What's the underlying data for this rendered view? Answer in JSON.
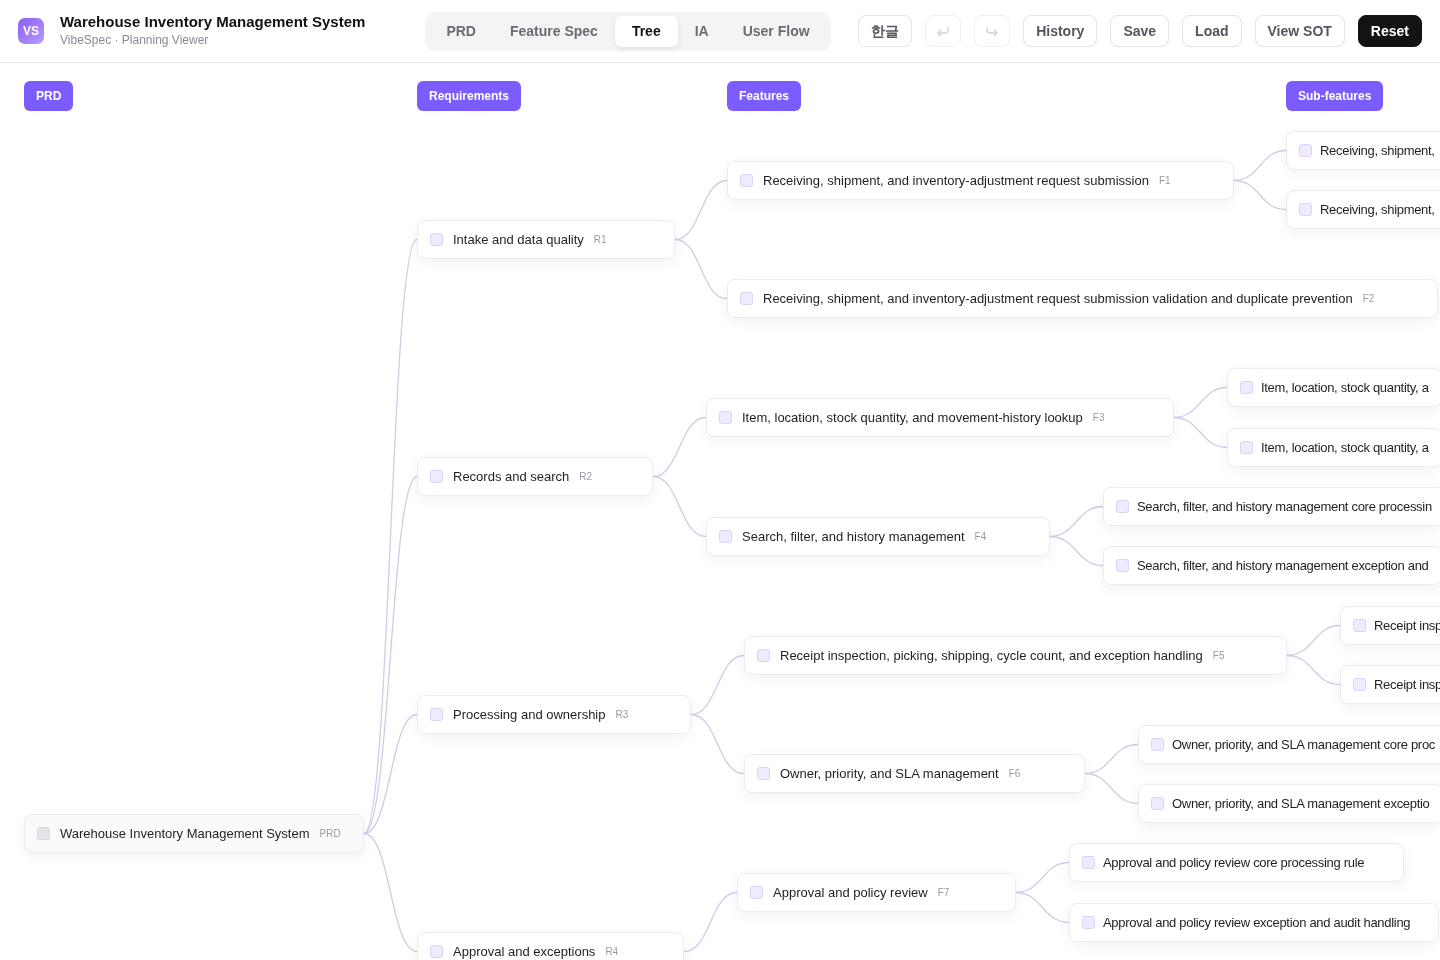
{
  "app": {
    "logo": "VS",
    "title": "Warehouse Inventory Management System",
    "subtitle": "VibeSpec · Planning Viewer"
  },
  "tabs": [
    {
      "label": "PRD",
      "selected": false
    },
    {
      "label": "Feature Spec",
      "selected": false
    },
    {
      "label": "Tree",
      "selected": true
    },
    {
      "label": "IA",
      "selected": false
    },
    {
      "label": "User Flow",
      "selected": false
    }
  ],
  "toolbar": [
    {
      "kind": "text",
      "label": "한글",
      "disabled": false
    },
    {
      "kind": "undo",
      "disabled": true
    },
    {
      "kind": "redo",
      "disabled": true
    },
    {
      "kind": "text",
      "label": "History",
      "disabled": false
    },
    {
      "kind": "text",
      "label": "Save",
      "disabled": false
    },
    {
      "kind": "text",
      "label": "Load",
      "disabled": false
    },
    {
      "kind": "text",
      "label": "View SOT",
      "disabled": false
    },
    {
      "kind": "primary",
      "label": "Reset",
      "disabled": false
    }
  ],
  "column_headers": [
    "PRD",
    "Requirements",
    "Features",
    "Sub-features"
  ],
  "tree": {
    "label": "Warehouse Inventory Management System",
    "code": "PRD",
    "checked": false,
    "children": [
      {
        "label": "Intake and data quality",
        "code": "R1",
        "checked": false,
        "children": [
          {
            "label": "Receiving, shipment, and inventory-adjustment request submission",
            "code": "F1",
            "checked": false,
            "children": [
              {
                "label": "Receiving, shipment,",
                "checked": false
              },
              {
                "label": "Receiving, shipment,",
                "checked": false
              }
            ]
          },
          {
            "label": "Receiving, shipment, and inventory-adjustment request submission validation and duplicate prevention",
            "code": "F2",
            "checked": false
          }
        ]
      },
      {
        "label": "Records and search",
        "code": "R2",
        "checked": false,
        "children": [
          {
            "label": "Item, location, stock quantity, and movement-history lookup",
            "code": "F3",
            "checked": false,
            "children": [
              {
                "label": "Item, location, stock quantity, a",
                "checked": false
              },
              {
                "label": "Item, location, stock quantity, a",
                "checked": false
              }
            ]
          },
          {
            "label": "Search, filter, and history management",
            "code": "F4",
            "checked": false,
            "children": [
              {
                "label": "Search, filter, and history management core processin",
                "checked": false
              },
              {
                "label": "Search, filter, and history management exception and",
                "checked": false
              }
            ]
          }
        ]
      },
      {
        "label": "Processing and ownership",
        "code": "R3",
        "checked": false,
        "children": [
          {
            "label": "Receipt inspection, picking, shipping, cycle count, and exception handling",
            "code": "F5",
            "checked": false,
            "children": [
              {
                "label": "Receipt insp",
                "checked": false
              },
              {
                "label": "Receipt insp",
                "checked": false
              }
            ]
          },
          {
            "label": "Owner, priority, and SLA management",
            "code": "F6",
            "checked": false,
            "children": [
              {
                "label": "Owner, priority, and SLA management core proc",
                "checked": false
              },
              {
                "label": "Owner, priority, and SLA management exceptio",
                "checked": false
              }
            ]
          }
        ]
      },
      {
        "label": "Approval and exceptions",
        "code": "R4",
        "checked": false,
        "children": [
          {
            "label": "Approval and policy review",
            "code": "F7",
            "checked": false,
            "children": [
              {
                "label": "Approval and policy review core processing rule",
                "checked": false
              },
              {
                "label": "Approval and policy review exception and audit handling",
                "checked": false
              }
            ]
          }
        ]
      }
    ]
  }
}
